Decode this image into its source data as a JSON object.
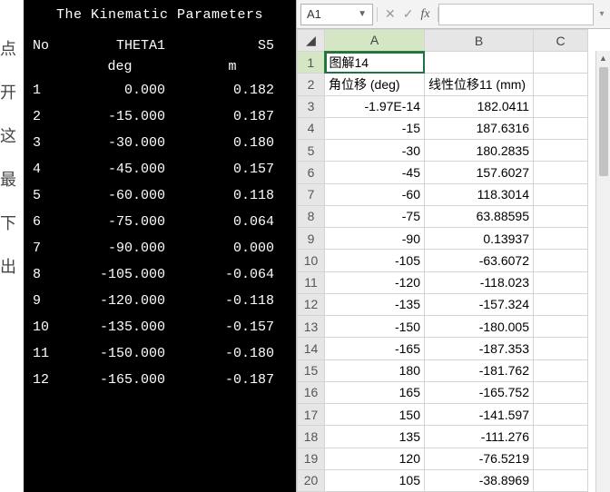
{
  "leftstrip": [
    "点",
    "开",
    "这",
    "最",
    "下",
    "出"
  ],
  "terminal": {
    "title": "The Kinematic Parameters",
    "headers": {
      "no": "No",
      "th": "THETA1",
      "s5": "S5",
      "th_unit": "deg",
      "s5_unit": "m"
    },
    "rows": [
      {
        "n": "1",
        "t": "0.000",
        "s": "0.182"
      },
      {
        "n": "2",
        "t": "-15.000",
        "s": "0.187"
      },
      {
        "n": "3",
        "t": "-30.000",
        "s": "0.180"
      },
      {
        "n": "4",
        "t": "-45.000",
        "s": "0.157"
      },
      {
        "n": "5",
        "t": "-60.000",
        "s": "0.118"
      },
      {
        "n": "6",
        "t": "-75.000",
        "s": "0.064"
      },
      {
        "n": "7",
        "t": "-90.000",
        "s": "0.000"
      },
      {
        "n": "8",
        "t": "-105.000",
        "s": "-0.064"
      },
      {
        "n": "9",
        "t": "-120.000",
        "s": "-0.118"
      },
      {
        "n": "10",
        "t": "-135.000",
        "s": "-0.157"
      },
      {
        "n": "11",
        "t": "-150.000",
        "s": "-0.180"
      },
      {
        "n": "12",
        "t": "-165.000",
        "s": "-0.187"
      }
    ]
  },
  "sheet": {
    "name_box": "A1",
    "colheads": {
      "A": "A",
      "B": "B",
      "C": "C"
    },
    "rows": [
      {
        "r": "1",
        "A": "图解14",
        "B": "",
        "C": "",
        "Anum": false
      },
      {
        "r": "2",
        "A": "角位移 (deg)",
        "B": "线性位移11 (mm)",
        "C": "",
        "Anum": false
      },
      {
        "r": "3",
        "A": "-1.97E-14",
        "B": "182.0411",
        "C": "",
        "Anum": true
      },
      {
        "r": "4",
        "A": "-15",
        "B": "187.6316",
        "C": "",
        "Anum": true
      },
      {
        "r": "5",
        "A": "-30",
        "B": "180.2835",
        "C": "",
        "Anum": true
      },
      {
        "r": "6",
        "A": "-45",
        "B": "157.6027",
        "C": "",
        "Anum": true
      },
      {
        "r": "7",
        "A": "-60",
        "B": "118.3014",
        "C": "",
        "Anum": true
      },
      {
        "r": "8",
        "A": "-75",
        "B": "63.88595",
        "C": "",
        "Anum": true
      },
      {
        "r": "9",
        "A": "-90",
        "B": "0.13937",
        "C": "",
        "Anum": true
      },
      {
        "r": "10",
        "A": "-105",
        "B": "-63.6072",
        "C": "",
        "Anum": true
      },
      {
        "r": "11",
        "A": "-120",
        "B": "-118.023",
        "C": "",
        "Anum": true
      },
      {
        "r": "12",
        "A": "-135",
        "B": "-157.324",
        "C": "",
        "Anum": true
      },
      {
        "r": "13",
        "A": "-150",
        "B": "-180.005",
        "C": "",
        "Anum": true
      },
      {
        "r": "14",
        "A": "-165",
        "B": "-187.353",
        "C": "",
        "Anum": true
      },
      {
        "r": "15",
        "A": "180",
        "B": "-181.762",
        "C": "",
        "Anum": true
      },
      {
        "r": "16",
        "A": "165",
        "B": "-165.752",
        "C": "",
        "Anum": true
      },
      {
        "r": "17",
        "A": "150",
        "B": "-141.597",
        "C": "",
        "Anum": true
      },
      {
        "r": "18",
        "A": "135",
        "B": "-111.276",
        "C": "",
        "Anum": true
      },
      {
        "r": "19",
        "A": "120",
        "B": "-76.5219",
        "C": "",
        "Anum": true
      },
      {
        "r": "20",
        "A": "105",
        "B": "-38.8969",
        "C": "",
        "Anum": true
      }
    ],
    "sel_row": "1",
    "sel_col": "A"
  },
  "chart_data": {
    "type": "table",
    "series": [
      {
        "name": "THETA1 (deg)",
        "values": [
          0,
          -15,
          -30,
          -45,
          -60,
          -75,
          -90,
          -105,
          -120,
          -135,
          -150,
          -165
        ]
      },
      {
        "name": "S5 (m)",
        "values": [
          0.182,
          0.187,
          0.18,
          0.157,
          0.118,
          0.064,
          0.0,
          -0.064,
          -0.118,
          -0.157,
          -0.18,
          -0.187
        ]
      },
      {
        "name": "角位移 (deg)",
        "values": [
          -1.97e-14,
          -15,
          -30,
          -45,
          -60,
          -75,
          -90,
          -105,
          -120,
          -135,
          -150,
          -165,
          180,
          165,
          150,
          135,
          120,
          105
        ]
      },
      {
        "name": "线性位移11 (mm)",
        "values": [
          182.0411,
          187.6316,
          180.2835,
          157.6027,
          118.3014,
          63.88595,
          0.13937,
          -63.6072,
          -118.023,
          -157.324,
          -180.005,
          -187.353,
          -181.762,
          -165.752,
          -141.597,
          -111.276,
          -76.5219,
          -38.8969
        ]
      }
    ]
  }
}
